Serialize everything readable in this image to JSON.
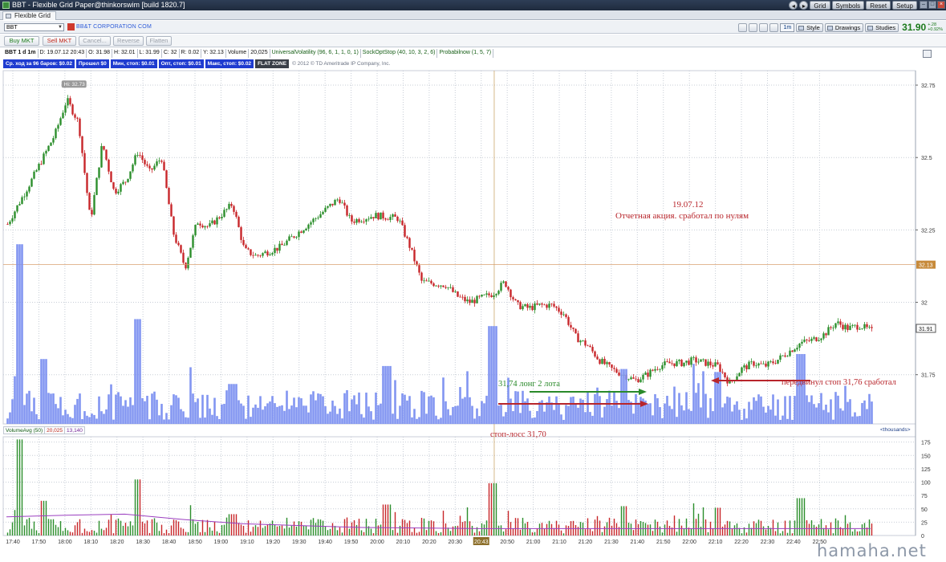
{
  "window": {
    "title": "BBT - Flexible Grid Paper@thinkorswim [build 1820.7]",
    "buttons": [
      "Grid",
      "Symbols",
      "Reset",
      "Setup"
    ]
  },
  "tab": {
    "label": "Flexible Grid"
  },
  "symbol_bar": {
    "symbol": "BBT",
    "company": "BB&T CORPORATION COM",
    "aggregation": "1m",
    "buttons": [
      "Style",
      "Drawings",
      "Studies"
    ],
    "last_price": "31.90",
    "net_change": "+.28",
    "net_change_pct": "+0.92%"
  },
  "order_bar": {
    "buttons": [
      {
        "label": "Buy MKT",
        "state": "buy"
      },
      {
        "label": "Sell MKT",
        "state": "sell"
      },
      {
        "label": "Cancel...",
        "state": "disabled"
      },
      {
        "label": "Reverse",
        "state": "disabled"
      },
      {
        "label": "Flatten",
        "state": "disabled"
      }
    ]
  },
  "status_line": {
    "symbol": "BBT 1 d 1m",
    "date": "D: 19.07.12 20:43",
    "open": "O: 31.98",
    "high": "H: 32.01",
    "low": "L: 31.99",
    "close": "C: 32",
    "range": "R: 0.02",
    "y": "Y: 32.13",
    "volume_label": "Volume",
    "volume_value": "20,025",
    "studies": [
      "UniversalVolatility (96, 6, 1, 1, 0, 1)",
      "SockOptStop (40, 10, 3, 2, 6)",
      "Probabilnow (1, 5, 7)"
    ]
  },
  "pl_bar": {
    "items": [
      "Ср. ход за 96 баров: $0.02",
      "Прошел $0",
      "Мин, стоп: $0.01",
      "Опт, стоп: $0.01",
      "Макс, стоп: $0.02"
    ],
    "flat": "FLAT ZONE",
    "copyright": "© 2012 © TD Ameritrade IP Company, Inc."
  },
  "annotations": {
    "date": "19.07.12",
    "summary": "Отчетная акция. сработал по нулям",
    "entry": "31,74 лонг 2 лота",
    "stop_move": "передвинул стоп 31,76 сработал",
    "stop_loss": "стоп-лосс 31,70"
  },
  "volume_header": {
    "study": "VolumeAvg (50)",
    "value": "20,025",
    "avg": "13,140",
    "units": "<thousands>"
  },
  "watermark": "hamaha.net",
  "colors": {
    "up": "#2c8f2c",
    "down": "#c8262a",
    "volume_bar": "#7b8ff0",
    "avg_line": "#9b3fc0",
    "annotation_red": "#b8252b",
    "annotation_green": "#2a8a2a",
    "hi_label_bg": "#9a9a9a",
    "prev_close": "#d8a070"
  },
  "chart_data": {
    "type": "candlestick",
    "ylim": [
      31.58,
      32.8
    ],
    "yticks": [
      31.75,
      32,
      32.25,
      32.5,
      32.75
    ],
    "ytick_labels": [
      "31.75",
      "32",
      "32.25",
      "32.5",
      "32.75"
    ],
    "high_label": "Hi: 32.73",
    "prev_close_price": 32.13,
    "prev_close_label": "32.13",
    "last_price_label": "31.91",
    "x_labels": [
      "17:40",
      "17:50",
      "18:00",
      "18:10",
      "18:20",
      "18:30",
      "18:40",
      "18:50",
      "19:00",
      "19:10",
      "19:20",
      "19:30",
      "19:40",
      "19:50",
      "20:00",
      "20:10",
      "20:20",
      "20:30",
      "20:43",
      "20:50",
      "21:00",
      "21:10",
      "21:20",
      "21:30",
      "21:40",
      "21:50",
      "22:00",
      "22:10",
      "22:20",
      "22:30",
      "22:40",
      "22:50"
    ],
    "x_label_highlight": "20:43",
    "volume_ylim": [
      0,
      185
    ],
    "volume_yticks": [
      0,
      25,
      50,
      75,
      100,
      125,
      150,
      175
    ],
    "close_path": [
      [
        0,
        32.27
      ],
      [
        2,
        32.42
      ],
      [
        4,
        32.58
      ],
      [
        5,
        32.7
      ],
      [
        6,
        32.62
      ],
      [
        7,
        32.28
      ],
      [
        8,
        32.55
      ],
      [
        9,
        32.38
      ],
      [
        10,
        32.42
      ],
      [
        11,
        32.52
      ],
      [
        12,
        32.45
      ],
      [
        13,
        32.5
      ],
      [
        14,
        32.24
      ],
      [
        15,
        32.12
      ],
      [
        16,
        32.28
      ],
      [
        17,
        32.26
      ],
      [
        19,
        32.34
      ],
      [
        20,
        32.18
      ],
      [
        21,
        32.16
      ],
      [
        23,
        32.19
      ],
      [
        26,
        32.29
      ],
      [
        28,
        32.36
      ],
      [
        29,
        32.28
      ],
      [
        31,
        32.3
      ],
      [
        33,
        32.29
      ],
      [
        34,
        32.19
      ],
      [
        35,
        32.07
      ],
      [
        37,
        32.06
      ],
      [
        38,
        32.02
      ],
      [
        39,
        32.0
      ],
      [
        41,
        32.03
      ],
      [
        42,
        32.07
      ],
      [
        43,
        31.99
      ],
      [
        44,
        31.98
      ],
      [
        45,
        31.99
      ],
      [
        46,
        31.99
      ],
      [
        47,
        31.96
      ],
      [
        48,
        31.88
      ],
      [
        49,
        31.85
      ],
      [
        50,
        31.8
      ],
      [
        51,
        31.77
      ],
      [
        52,
        31.75
      ],
      [
        53,
        31.73
      ],
      [
        54,
        31.75
      ],
      [
        55,
        31.78
      ],
      [
        56,
        31.79
      ],
      [
        57,
        31.79
      ],
      [
        58,
        31.8
      ],
      [
        59,
        31.79
      ],
      [
        60,
        31.78
      ],
      [
        61,
        31.72
      ],
      [
        62,
        31.77
      ],
      [
        63,
        31.79
      ],
      [
        64,
        31.78
      ],
      [
        65,
        31.8
      ],
      [
        66,
        31.83
      ],
      [
        67,
        31.86
      ],
      [
        68,
        31.87
      ],
      [
        69,
        31.89
      ],
      [
        70,
        31.93
      ],
      [
        71,
        31.91
      ],
      [
        72,
        31.92
      ],
      [
        73,
        31.9
      ]
    ],
    "volume_spikes": [
      [
        1,
        180
      ],
      [
        3,
        65
      ],
      [
        11,
        105
      ],
      [
        19,
        40
      ],
      [
        32,
        58
      ],
      [
        41,
        98
      ],
      [
        52,
        55
      ],
      [
        60,
        52
      ],
      [
        67,
        70
      ]
    ],
    "volume_avg_path": [
      [
        0,
        35
      ],
      [
        5,
        38
      ],
      [
        10,
        40
      ],
      [
        15,
        30
      ],
      [
        20,
        22
      ],
      [
        30,
        15
      ],
      [
        40,
        13
      ],
      [
        50,
        13
      ],
      [
        60,
        13
      ],
      [
        73,
        13
      ]
    ]
  }
}
